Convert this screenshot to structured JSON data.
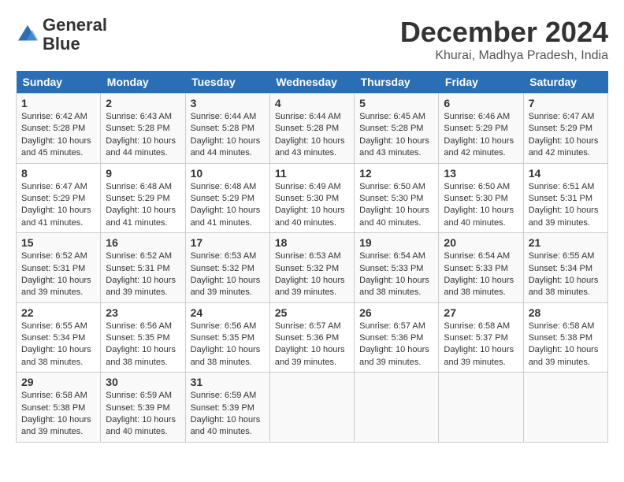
{
  "header": {
    "logo_line1": "General",
    "logo_line2": "Blue",
    "month_title": "December 2024",
    "location": "Khurai, Madhya Pradesh, India"
  },
  "days_of_week": [
    "Sunday",
    "Monday",
    "Tuesday",
    "Wednesday",
    "Thursday",
    "Friday",
    "Saturday"
  ],
  "weeks": [
    [
      {
        "day": "1",
        "info": "Sunrise: 6:42 AM\nSunset: 5:28 PM\nDaylight: 10 hours\nand 45 minutes."
      },
      {
        "day": "2",
        "info": "Sunrise: 6:43 AM\nSunset: 5:28 PM\nDaylight: 10 hours\nand 44 minutes."
      },
      {
        "day": "3",
        "info": "Sunrise: 6:44 AM\nSunset: 5:28 PM\nDaylight: 10 hours\nand 44 minutes."
      },
      {
        "day": "4",
        "info": "Sunrise: 6:44 AM\nSunset: 5:28 PM\nDaylight: 10 hours\nand 43 minutes."
      },
      {
        "day": "5",
        "info": "Sunrise: 6:45 AM\nSunset: 5:28 PM\nDaylight: 10 hours\nand 43 minutes."
      },
      {
        "day": "6",
        "info": "Sunrise: 6:46 AM\nSunset: 5:29 PM\nDaylight: 10 hours\nand 42 minutes."
      },
      {
        "day": "7",
        "info": "Sunrise: 6:47 AM\nSunset: 5:29 PM\nDaylight: 10 hours\nand 42 minutes."
      }
    ],
    [
      {
        "day": "8",
        "info": "Sunrise: 6:47 AM\nSunset: 5:29 PM\nDaylight: 10 hours\nand 41 minutes."
      },
      {
        "day": "9",
        "info": "Sunrise: 6:48 AM\nSunset: 5:29 PM\nDaylight: 10 hours\nand 41 minutes."
      },
      {
        "day": "10",
        "info": "Sunrise: 6:48 AM\nSunset: 5:29 PM\nDaylight: 10 hours\nand 41 minutes."
      },
      {
        "day": "11",
        "info": "Sunrise: 6:49 AM\nSunset: 5:30 PM\nDaylight: 10 hours\nand 40 minutes."
      },
      {
        "day": "12",
        "info": "Sunrise: 6:50 AM\nSunset: 5:30 PM\nDaylight: 10 hours\nand 40 minutes."
      },
      {
        "day": "13",
        "info": "Sunrise: 6:50 AM\nSunset: 5:30 PM\nDaylight: 10 hours\nand 40 minutes."
      },
      {
        "day": "14",
        "info": "Sunrise: 6:51 AM\nSunset: 5:31 PM\nDaylight: 10 hours\nand 39 minutes."
      }
    ],
    [
      {
        "day": "15",
        "info": "Sunrise: 6:52 AM\nSunset: 5:31 PM\nDaylight: 10 hours\nand 39 minutes."
      },
      {
        "day": "16",
        "info": "Sunrise: 6:52 AM\nSunset: 5:31 PM\nDaylight: 10 hours\nand 39 minutes."
      },
      {
        "day": "17",
        "info": "Sunrise: 6:53 AM\nSunset: 5:32 PM\nDaylight: 10 hours\nand 39 minutes."
      },
      {
        "day": "18",
        "info": "Sunrise: 6:53 AM\nSunset: 5:32 PM\nDaylight: 10 hours\nand 39 minutes."
      },
      {
        "day": "19",
        "info": "Sunrise: 6:54 AM\nSunset: 5:33 PM\nDaylight: 10 hours\nand 38 minutes."
      },
      {
        "day": "20",
        "info": "Sunrise: 6:54 AM\nSunset: 5:33 PM\nDaylight: 10 hours\nand 38 minutes."
      },
      {
        "day": "21",
        "info": "Sunrise: 6:55 AM\nSunset: 5:34 PM\nDaylight: 10 hours\nand 38 minutes."
      }
    ],
    [
      {
        "day": "22",
        "info": "Sunrise: 6:55 AM\nSunset: 5:34 PM\nDaylight: 10 hours\nand 38 minutes."
      },
      {
        "day": "23",
        "info": "Sunrise: 6:56 AM\nSunset: 5:35 PM\nDaylight: 10 hours\nand 38 minutes."
      },
      {
        "day": "24",
        "info": "Sunrise: 6:56 AM\nSunset: 5:35 PM\nDaylight: 10 hours\nand 38 minutes."
      },
      {
        "day": "25",
        "info": "Sunrise: 6:57 AM\nSunset: 5:36 PM\nDaylight: 10 hours\nand 39 minutes."
      },
      {
        "day": "26",
        "info": "Sunrise: 6:57 AM\nSunset: 5:36 PM\nDaylight: 10 hours\nand 39 minutes."
      },
      {
        "day": "27",
        "info": "Sunrise: 6:58 AM\nSunset: 5:37 PM\nDaylight: 10 hours\nand 39 minutes."
      },
      {
        "day": "28",
        "info": "Sunrise: 6:58 AM\nSunset: 5:38 PM\nDaylight: 10 hours\nand 39 minutes."
      }
    ],
    [
      {
        "day": "29",
        "info": "Sunrise: 6:58 AM\nSunset: 5:38 PM\nDaylight: 10 hours\nand 39 minutes."
      },
      {
        "day": "30",
        "info": "Sunrise: 6:59 AM\nSunset: 5:39 PM\nDaylight: 10 hours\nand 40 minutes."
      },
      {
        "day": "31",
        "info": "Sunrise: 6:59 AM\nSunset: 5:39 PM\nDaylight: 10 hours\nand 40 minutes."
      },
      {
        "day": "",
        "info": ""
      },
      {
        "day": "",
        "info": ""
      },
      {
        "day": "",
        "info": ""
      },
      {
        "day": "",
        "info": ""
      }
    ]
  ]
}
